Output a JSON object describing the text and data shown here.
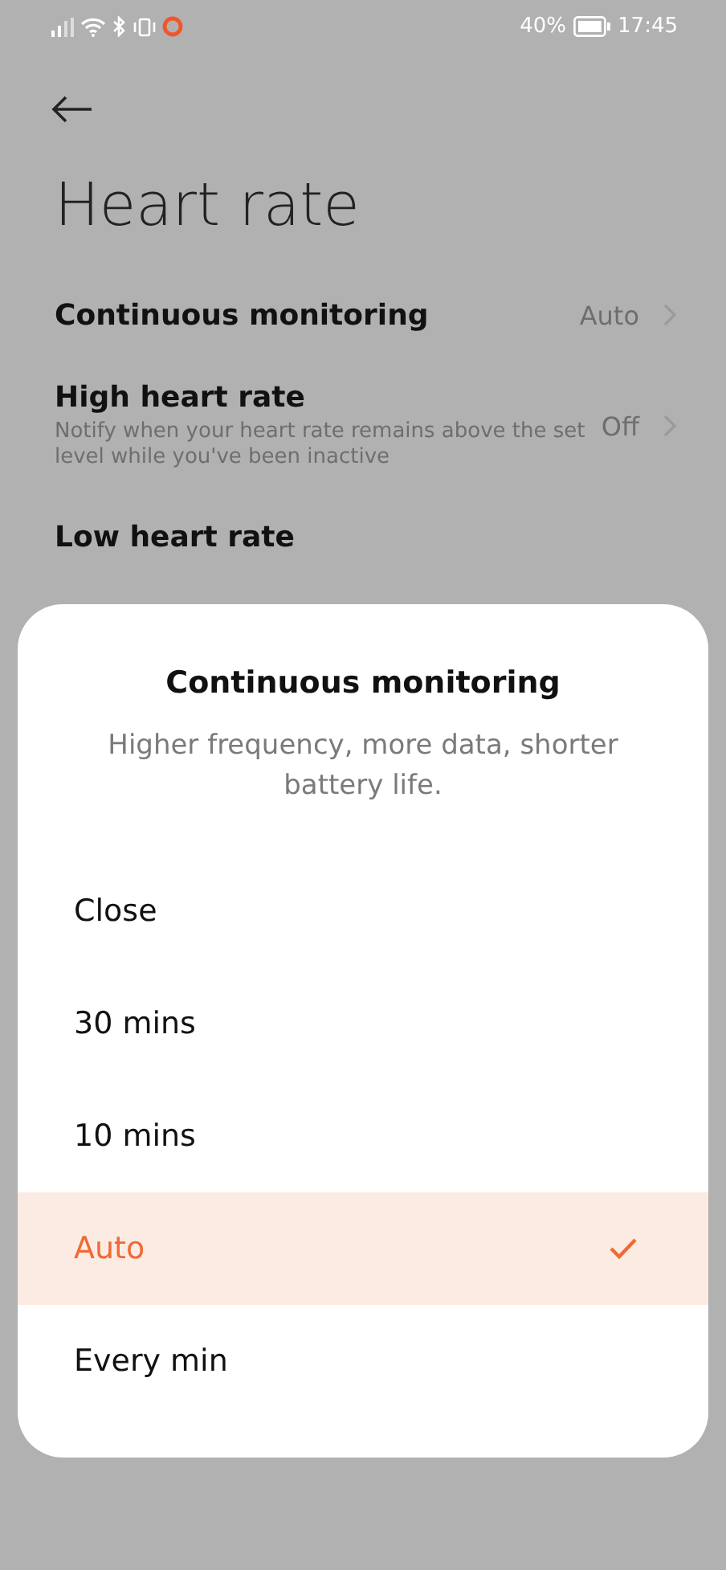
{
  "status_bar": {
    "battery": "40%",
    "time": "17:45"
  },
  "page": {
    "title": "Heart rate"
  },
  "settings": [
    {
      "title": "Continuous monitoring",
      "value": "Auto"
    },
    {
      "title": "High heart rate",
      "description": "Notify when your heart rate remains above the set level while you've been inactive",
      "value": "Off"
    },
    {
      "title": "Low heart rate"
    }
  ],
  "sheet": {
    "title": "Continuous monitoring",
    "subtitle": "Higher frequency, more data, shorter battery life.",
    "options": [
      {
        "label": "Close",
        "selected": false
      },
      {
        "label": "30 mins",
        "selected": false
      },
      {
        "label": "10 mins",
        "selected": false
      },
      {
        "label": "Auto",
        "selected": true
      },
      {
        "label": "Every min",
        "selected": false
      }
    ]
  }
}
